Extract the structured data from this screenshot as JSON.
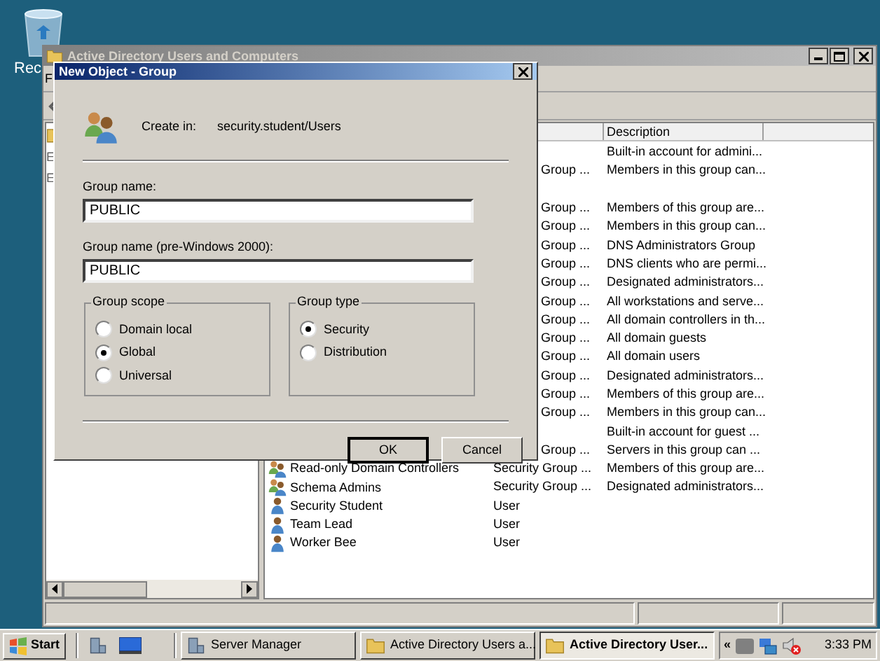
{
  "desktop": {
    "icons": [
      {
        "label": "Rec"
      }
    ]
  },
  "main_window": {
    "title": "Active Directory Users and Computers",
    "menu": [
      "F"
    ],
    "tree_items": [
      "E",
      "E"
    ],
    "columns": [
      "Description"
    ],
    "rows": [
      {
        "description": "Built-in account for admini..."
      },
      {
        "type": "Group ...",
        "description": "Members in this group can..."
      },
      {},
      {
        "type": "Group ...",
        "description": "Members of this group are..."
      },
      {
        "type": "Group ...",
        "description": "Members in this group can..."
      },
      {
        "type": "Group ...",
        "description": "DNS Administrators Group"
      },
      {
        "type": "Group ...",
        "description": "DNS clients who are permi..."
      },
      {
        "type": "Group ...",
        "description": "Designated administrators..."
      },
      {
        "type": "Group ...",
        "description": "All workstations and serve..."
      },
      {
        "type": "Group ...",
        "description": "All domain controllers in th..."
      },
      {
        "type": "Group ...",
        "description": "All domain guests"
      },
      {
        "type": "Group ...",
        "description": "All domain users"
      },
      {
        "type": "Group ...",
        "description": "Designated administrators..."
      },
      {
        "type": "Group ...",
        "description": "Members of this group are..."
      },
      {
        "type": "Group ...",
        "description": "Members in this group can..."
      },
      {
        "description": "Built-in account for guest ..."
      },
      {
        "type": "Group ...",
        "description": "Servers in this group can ..."
      },
      {
        "kind": "group",
        "name": "Read-only Domain Controllers",
        "type": "Security Group ...",
        "description": "Members of this group are..."
      },
      {
        "kind": "group",
        "name": "Schema Admins",
        "type": "Security Group ...",
        "description": "Designated administrators..."
      },
      {
        "kind": "user",
        "name": "Security Student",
        "type": "User"
      },
      {
        "kind": "user",
        "name": "Team Lead",
        "type": "User"
      },
      {
        "kind": "user",
        "name": "Worker Bee",
        "type": "User"
      }
    ]
  },
  "dialog": {
    "title": "New Object - Group",
    "create_in_label": "Create in:",
    "create_in_value": "security.student/Users",
    "fields": [
      {
        "label": "Group name:",
        "value": "PUBLIC"
      },
      {
        "label": "Group name (pre-Windows 2000):",
        "value": "PUBLIC"
      }
    ],
    "groups": [
      {
        "title": "Group scope",
        "options": [
          {
            "label": "Domain local",
            "selected": false
          },
          {
            "label": "Global",
            "selected": true
          },
          {
            "label": "Universal",
            "selected": false
          }
        ]
      },
      {
        "title": "Group type",
        "options": [
          {
            "label": "Security",
            "selected": true
          },
          {
            "label": "Distribution",
            "selected": false
          }
        ]
      }
    ],
    "buttons": [
      {
        "label": "OK",
        "default": true
      },
      {
        "label": "Cancel",
        "default": false
      }
    ]
  },
  "taskbar": {
    "start": "Start",
    "tasks": [
      {
        "kind": "server",
        "label": "Server Manager",
        "selected": false
      },
      {
        "kind": "folder",
        "label": "Active Directory Users a...",
        "selected": false
      },
      {
        "kind": "folder",
        "label": "Active Directory User...",
        "selected": true
      }
    ],
    "tray_expand": "«",
    "clock": "3:33 PM"
  }
}
